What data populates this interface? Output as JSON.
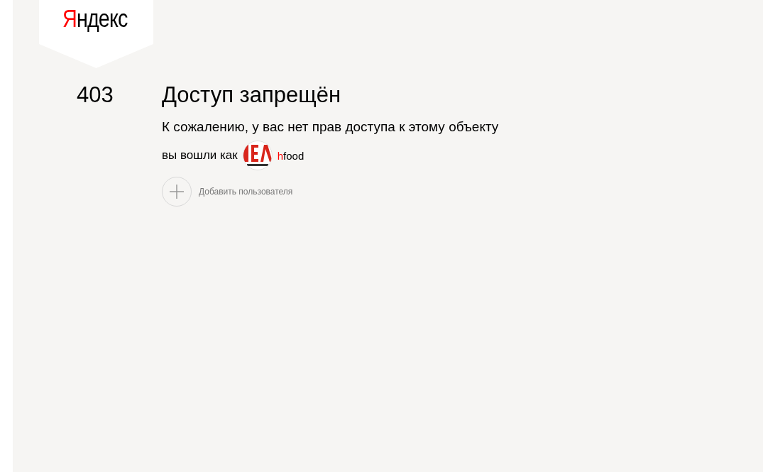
{
  "logo": {
    "accent": "Я",
    "rest": "ндекс"
  },
  "error": {
    "code": "403",
    "title": "Доступ запрещён",
    "message": "К сожалению, у вас нет прав доступа к этому объекту"
  },
  "account": {
    "label": "вы вошли как",
    "login_accent": "h",
    "login_rest": "food"
  },
  "add_user": {
    "label": "Добавить пользователя"
  }
}
